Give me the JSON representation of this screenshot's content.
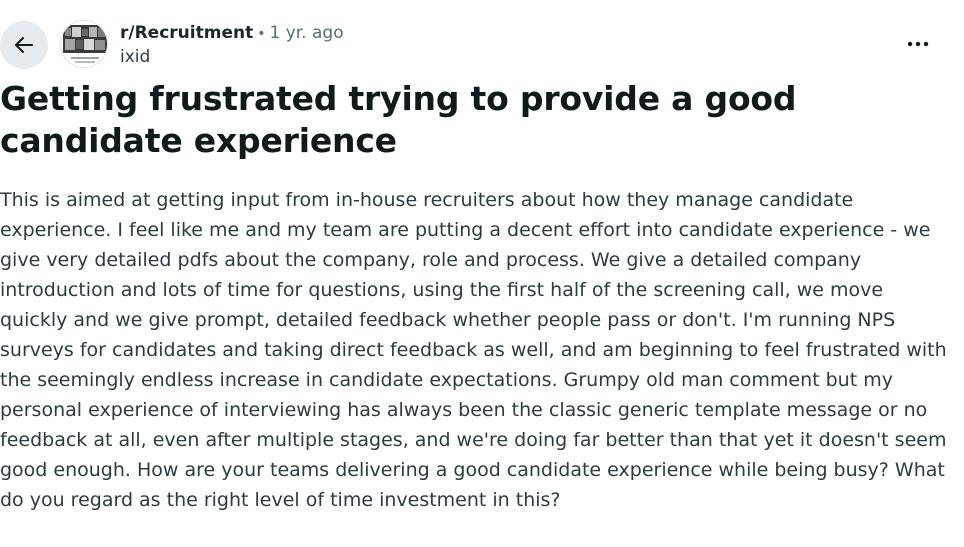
{
  "post": {
    "subreddit": "r/Recruitment",
    "separator": "•",
    "age": "1 yr. ago",
    "author": "ixid",
    "title": "Getting frustrated trying to provide a good candidate experience",
    "body": "This is aimed at getting input from in-house recruiters about how they manage candidate experience. I feel like me and my team are putting a decent effort into candidate experience - we give very detailed pdfs about the company, role and process. We give a detailed company introduction and lots of time for questions, using the first half of the screening call, we move quickly and we give prompt, detailed feedback whether people pass or don't. I'm running NPS surveys for candidates and taking direct feedback as well, and am beginning to feel frustrated with the seemingly endless increase in candidate expectations. Grumpy old man comment but my personal experience of interviewing has always been the classic generic template message or no feedback at all, even after multiple stages, and we're doing far better than that yet it doesn't seem good enough. How are your teams delivering a good candidate experience while being busy? What do you regard as the right level of time investment in this?"
  },
  "icons": {
    "back": "arrow-left-icon",
    "more": "more-horizontal-icon",
    "avatar": "subreddit-avatar"
  },
  "colors": {
    "text_primary": "#0f1a1c",
    "text_secondary": "#576f76",
    "back_button_bg": "#e5ebee"
  }
}
